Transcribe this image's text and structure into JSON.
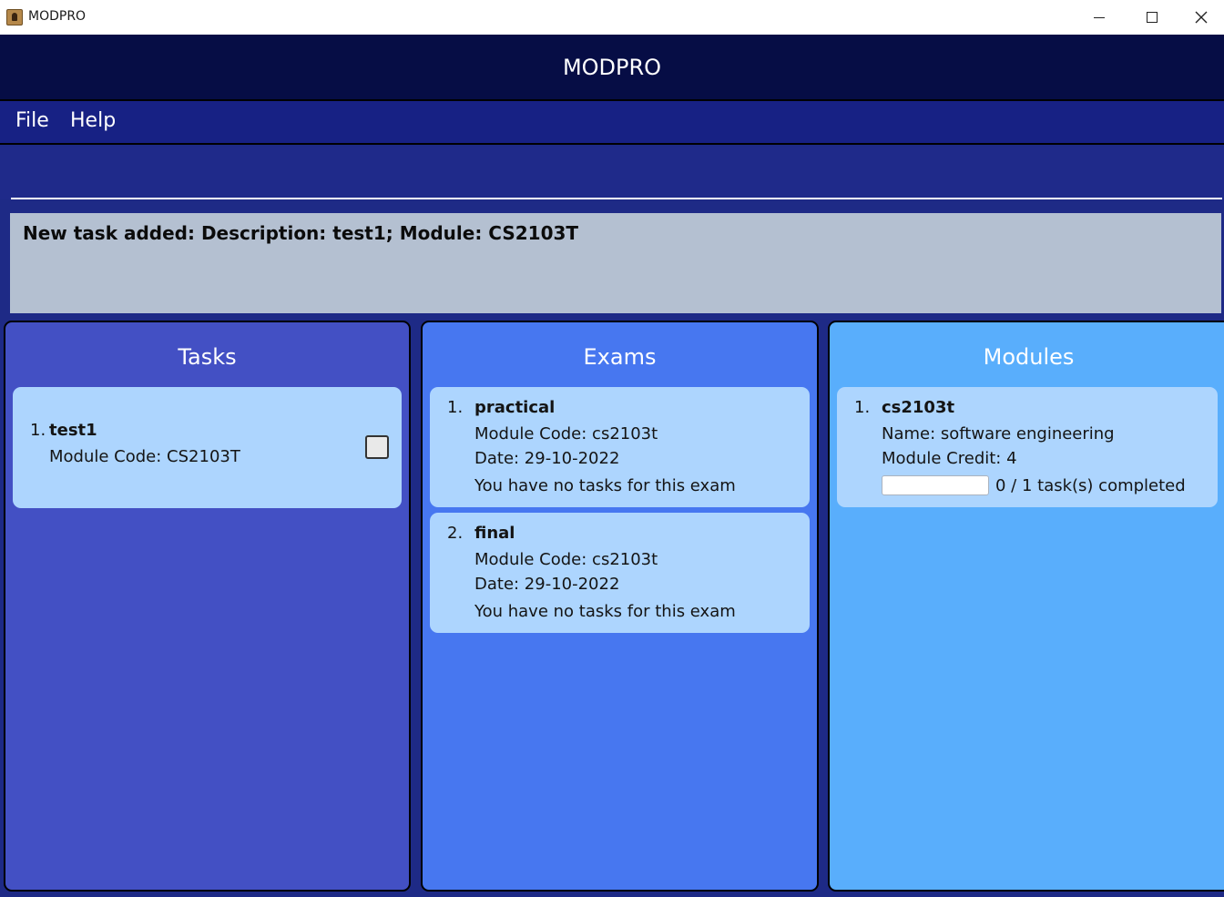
{
  "window": {
    "title": "MODPRO",
    "minimize": "—",
    "maximize": "☐",
    "close": "✕"
  },
  "header": {
    "title": "MODPRO"
  },
  "menu": {
    "file": "File",
    "help": "Help"
  },
  "command": {
    "value": "",
    "placeholder": ""
  },
  "result": {
    "text": "New task added: Description: test1; Module: CS2103T"
  },
  "tasks": {
    "title": "Tasks",
    "items": [
      {
        "index": "1.",
        "description": "test1",
        "module": "Module Code: CS2103T",
        "done": false
      }
    ]
  },
  "exams": {
    "title": "Exams",
    "items": [
      {
        "index": "1.",
        "name": "practical",
        "module": "Module Code: cs2103t",
        "date": "Date: 29-10-2022",
        "status": "You have no tasks for this exam"
      },
      {
        "index": "2.",
        "name": "final",
        "module": "Module Code: cs2103t",
        "date": "Date: 29-10-2022",
        "status": "You have no tasks for this exam"
      }
    ]
  },
  "modules": {
    "title": "Modules",
    "items": [
      {
        "index": "1.",
        "code": "cs2103t",
        "name": "Name: software engineering",
        "credit": "Module Credit: 4",
        "progress": 0,
        "progress_text": "0 / 1 task(s) completed"
      }
    ]
  }
}
